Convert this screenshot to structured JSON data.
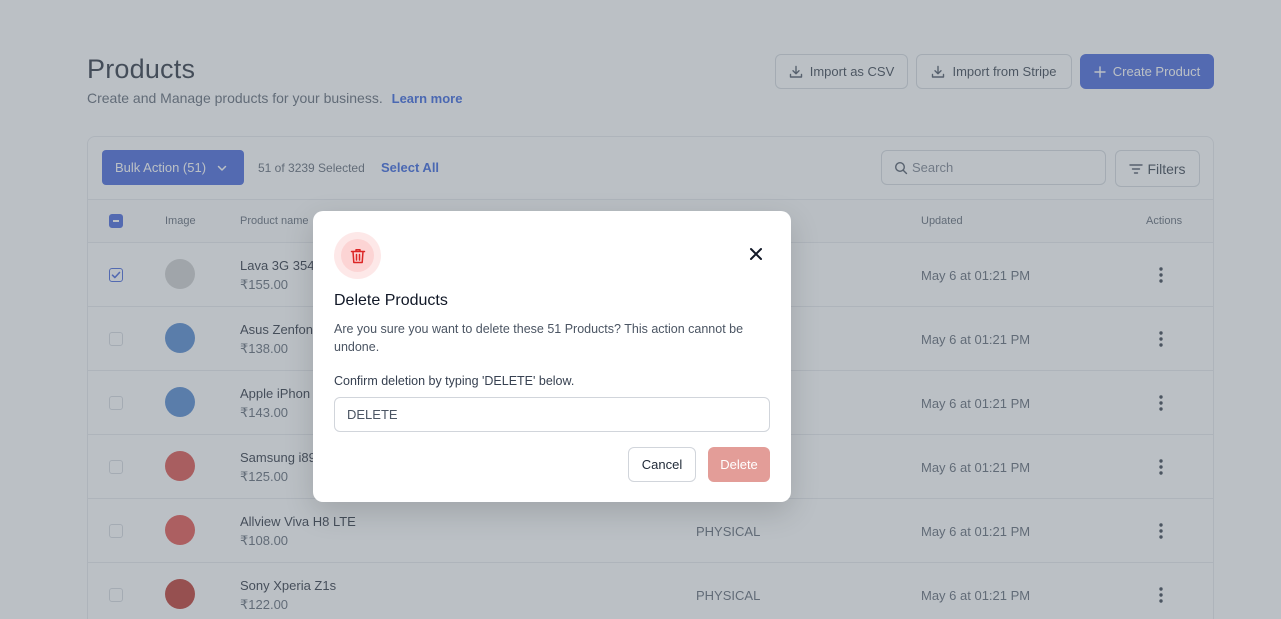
{
  "header": {
    "title": "Products",
    "subtitle": "Create and Manage products for your business.",
    "learn_more": "Learn more",
    "import_csv": "Import as CSV",
    "import_stripe": "Import from Stripe",
    "create_product": "Create Product"
  },
  "toolbar": {
    "bulk_action": "Bulk Action (51)",
    "selected_text": "51 of 3239 Selected",
    "select_all": "Select All",
    "search_placeholder": "Search",
    "filters": "Filters"
  },
  "table": {
    "columns": {
      "image": "Image",
      "product_name": "Product name",
      "updated": "Updated",
      "actions": "Actions"
    },
    "rows": [
      {
        "name": "Lava 3G 354",
        "price": "₹155.00",
        "type": "",
        "updated": "May 6 at 01:21 PM",
        "checked": true,
        "thumb_color": "#c8c8c8"
      },
      {
        "name": "Asus Zenfon",
        "price": "₹138.00",
        "type": "",
        "updated": "May 6 at 01:21 PM",
        "checked": false,
        "thumb_color": "#3d78c9"
      },
      {
        "name": "Apple iPhon",
        "price": "₹143.00",
        "type": "",
        "updated": "May 6 at 01:21 PM",
        "checked": false,
        "thumb_color": "#3d78c9"
      },
      {
        "name": "Samsung i89",
        "price": "₹125.00",
        "type": "",
        "updated": "May 6 at 01:21 PM",
        "checked": false,
        "thumb_color": "#d93a34"
      },
      {
        "name": "Allview Viva H8 LTE",
        "price": "₹108.00",
        "type": "PHYSICAL",
        "updated": "May 6 at 01:21 PM",
        "checked": false,
        "thumb_color": "#e03c36"
      },
      {
        "name": "Sony Xperia Z1s",
        "price": "₹122.00",
        "type": "PHYSICAL",
        "updated": "May 6 at 01:21 PM",
        "checked": false,
        "thumb_color": "#b41e14"
      }
    ]
  },
  "modal": {
    "title": "Delete Products",
    "description": "Are you sure you want to delete these 51 Products? This action cannot be undone.",
    "confirm_label": "Confirm deletion by typing 'DELETE' below.",
    "input_value": "DELETE",
    "cancel": "Cancel",
    "delete": "Delete"
  },
  "colors": {
    "primary": "#2f52d6",
    "danger_disabled": "#e39d98",
    "link": "#1d4ed8"
  }
}
